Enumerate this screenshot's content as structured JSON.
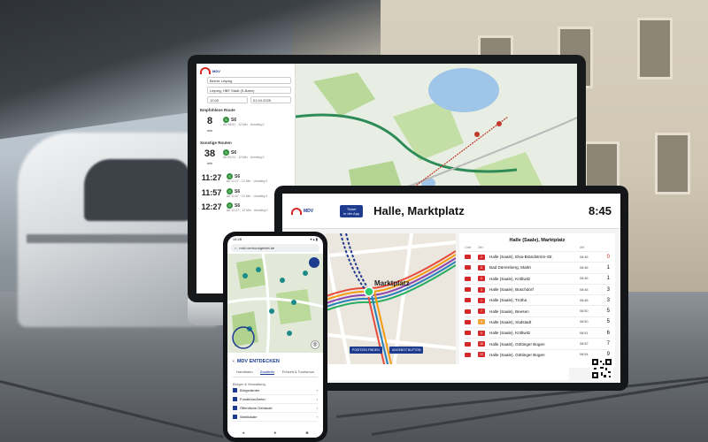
{
  "planner": {
    "brand": "MDV",
    "from": "Bernie Leipzig",
    "to": "Leipzig, HBF Stadt (S-Bahn)",
    "date": "01.04.2025",
    "time": "12:00",
    "section_best": "Empfohlene Route",
    "section_other": "Sonstige Routen",
    "connections": [
      {
        "time": "8",
        "unit": "min",
        "line": "S6",
        "sub": "Ab 08:51 · 12 Min · Umstieg 0"
      },
      {
        "time": "38",
        "unit": "min",
        "line": "S6",
        "sub": "Ab 09:21 · 12 Min · Umstieg 0"
      },
      {
        "time": "11:27",
        "unit": "",
        "line": "S6",
        "sub": "Ab 11:27 · 12 Min · Umstieg 0"
      },
      {
        "time": "11:57",
        "unit": "",
        "line": "S6",
        "sub": "Ab 11:57 · 12 Min · Umstieg 0"
      },
      {
        "time": "12:27",
        "unit": "",
        "line": "S6",
        "sub": "Ab 12:27 · 12 Min · Umstieg 0"
      }
    ]
  },
  "display": {
    "brand": "MDV",
    "ticket_label": "Ticket\nin der App",
    "stop_name": "Halle, Marktplatz",
    "clock": "8:45",
    "map_label": "Marktplatz",
    "departures_title": "Halle (Saale), Marktplatz",
    "head_line": "Linie",
    "head_dest": "Ziel",
    "head_time": "Abf.",
    "departures": [
      {
        "line": "2",
        "dest": "Halle (Saale), Elsa-Brändström-Str.",
        "time": "08:45",
        "min": "0",
        "color": "#d62828"
      },
      {
        "line": "8",
        "dest": "Bad Dürrenberg, Markt",
        "time": "08:46",
        "min": "1",
        "color": "#d62828"
      },
      {
        "line": "5",
        "dest": "Halle (Saale), Kröllwitz",
        "time": "08:46",
        "min": "1",
        "color": "#d62828"
      },
      {
        "line": "3",
        "dest": "Halle (Saale), Büschdorf",
        "time": "08:48",
        "min": "3",
        "color": "#d62828"
      },
      {
        "line": "1",
        "dest": "Halle (Saale), Trotha",
        "time": "08:48",
        "min": "3",
        "color": "#d62828"
      },
      {
        "line": "7",
        "dest": "Halle (Saale), Beesen",
        "time": "08:50",
        "min": "5",
        "color": "#d62828"
      },
      {
        "line": "4",
        "dest": "Halle (Saale), Südstadt",
        "time": "08:50",
        "min": "5",
        "color": "#f2a33a"
      },
      {
        "line": "5",
        "dest": "Halle (Saale), Kröllwitz",
        "time": "08:51",
        "min": "6",
        "color": "#d62828"
      },
      {
        "line": "16",
        "dest": "Halle (Saale), Göttinger Bogen",
        "time": "08:52",
        "min": "7",
        "color": "#d62828"
      },
      {
        "line": "10",
        "dest": "Halle (Saale), Göttinger Bogen",
        "time": "08:54",
        "min": "9",
        "color": "#d62828"
      }
    ],
    "btn_position": "POSITION FINDEN",
    "btn_ticket": "ANGEBOT BUTTON"
  },
  "phone": {
    "status_time": "14:28",
    "status_icons": "▾ ▴ ▮",
    "url": "mdv-verbundgebiet.de",
    "sheet_title": "MDV ENTDECKEN",
    "tabs": [
      "Handbahn",
      "Stadtteile",
      "Freizeit & Tourismus"
    ],
    "active_tab": 1,
    "group_label": "Bürger & Verwaltung",
    "items": [
      {
        "label": "Bürgerämter"
      },
      {
        "label": "Fundbüro/Ämter"
      },
      {
        "label": "Öffentliche Gebäude"
      },
      {
        "label": "Wahllokale"
      }
    ],
    "nav": [
      "◂",
      "●",
      "■"
    ]
  },
  "colors": {
    "brand_blue": "#1d3b8f",
    "brand_red": "#d62828",
    "line_green": "#2f8f3a"
  }
}
